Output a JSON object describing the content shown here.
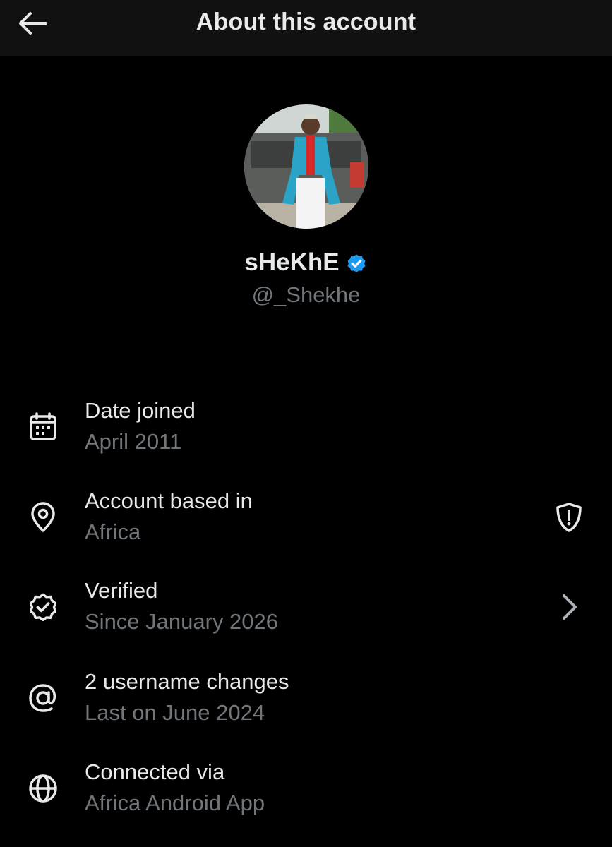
{
  "header": {
    "title": "About this account",
    "back_icon": "arrow-left-icon"
  },
  "profile": {
    "display_name": "sHeKhE",
    "verified_icon": "verified-badge-icon",
    "verified_color": "#1d9bf0",
    "handle": "@_Shekhe"
  },
  "details": [
    {
      "icon": "calendar-icon",
      "title": "Date joined",
      "subtitle": "April 2011"
    },
    {
      "icon": "location-pin-icon",
      "title": "Account based in",
      "subtitle": "Africa",
      "trailing_icon": "shield-alert-icon"
    },
    {
      "icon": "verified-outline-icon",
      "title": "Verified",
      "subtitle": "Since January 2026",
      "trailing_icon": "chevron-right-icon"
    },
    {
      "icon": "at-sign-icon",
      "title": "2 username changes",
      "subtitle": "Last on June 2024"
    },
    {
      "icon": "globe-icon",
      "title": "Connected via",
      "subtitle": "Africa Android App"
    }
  ],
  "colors": {
    "background": "#000000",
    "header_bg": "#111111",
    "primary_text": "#e7e9ea",
    "secondary_text": "#71767b"
  }
}
